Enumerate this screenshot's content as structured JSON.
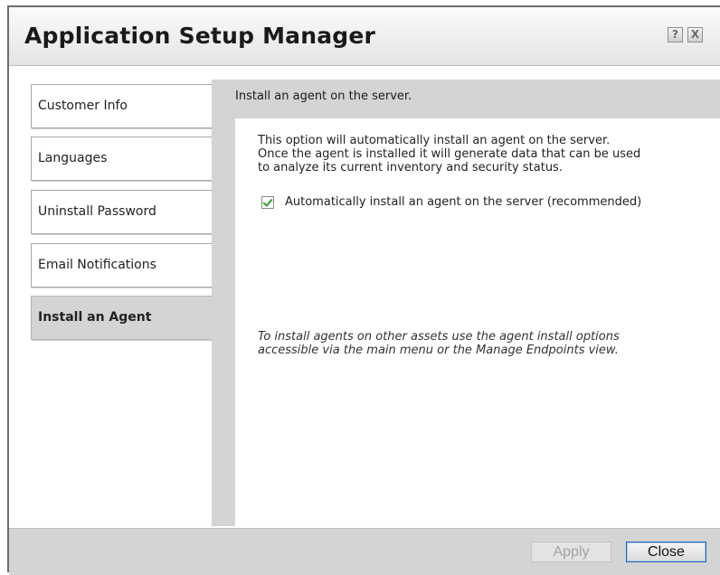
{
  "window": {
    "title": "Application Setup Manager",
    "help_glyph": "?",
    "close_glyph": "X"
  },
  "tabs": [
    {
      "label": "Customer Info",
      "active": false
    },
    {
      "label": "Languages",
      "active": false
    },
    {
      "label": "Uninstall Password",
      "active": false
    },
    {
      "label": "Email Notifications",
      "active": false
    },
    {
      "label": "Install an Agent",
      "active": true
    }
  ],
  "panel": {
    "header": "Install an agent on the server.",
    "description_lines": [
      "This option will automatically install an agent on the server.",
      "Once the agent is installed it will generate data that can be used",
      "to analyze its current inventory and security status."
    ],
    "checkbox": {
      "label": "Automatically install an agent on the server (recommended)",
      "checked": true
    },
    "note_lines": [
      "To install agents on other assets use the agent install options",
      "accessible via the main menu or the Manage Endpoints view."
    ]
  },
  "footer": {
    "apply_label": "Apply",
    "apply_enabled": false,
    "close_label": "Close"
  },
  "colors": {
    "panel_bg": "#d4d4d4",
    "check_color": "#2e9c2e",
    "focus_border": "#1f65b5"
  },
  "icons": {
    "help": "help-icon",
    "close": "close-icon",
    "check": "checkmark-icon"
  }
}
